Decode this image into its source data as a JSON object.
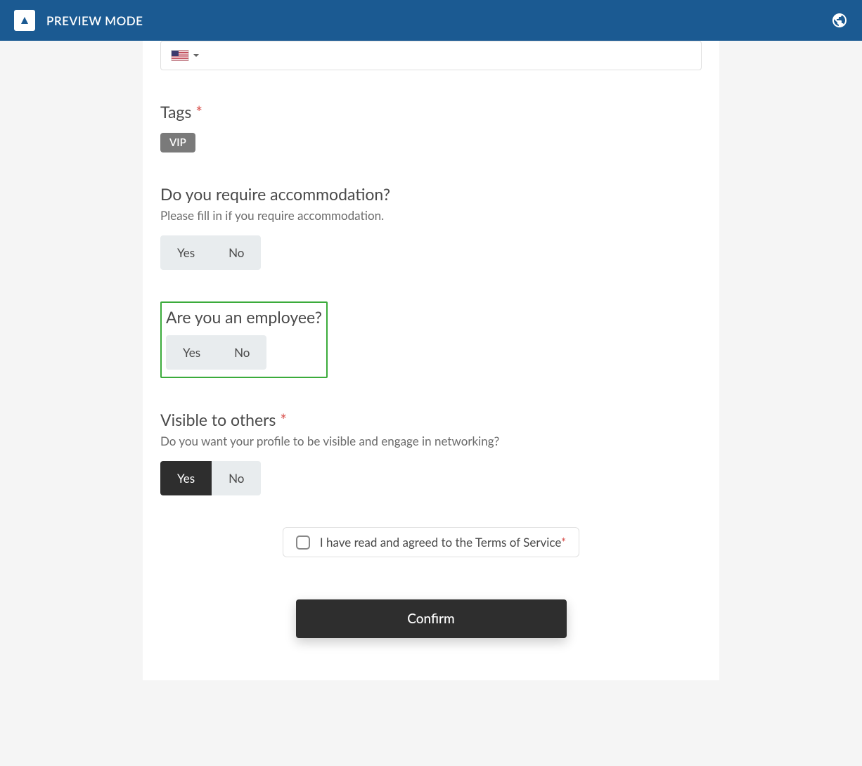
{
  "header": {
    "title": "PREVIEW MODE"
  },
  "form": {
    "tags": {
      "label": "Tags",
      "value": "VIP"
    },
    "accommodation": {
      "label": "Do you require accommodation?",
      "description": "Please fill in if you require accommodation.",
      "yes": "Yes",
      "no": "No"
    },
    "employee": {
      "label": "Are you an employee?",
      "yes": "Yes",
      "no": "No"
    },
    "visible": {
      "label": "Visible to others",
      "description": "Do you want your profile to be visible and engage in networking?",
      "yes": "Yes",
      "no": "No",
      "selected": "Yes"
    },
    "terms": {
      "text": "I have read and agreed to the Terms of Service"
    },
    "confirm": {
      "label": "Confirm"
    }
  }
}
